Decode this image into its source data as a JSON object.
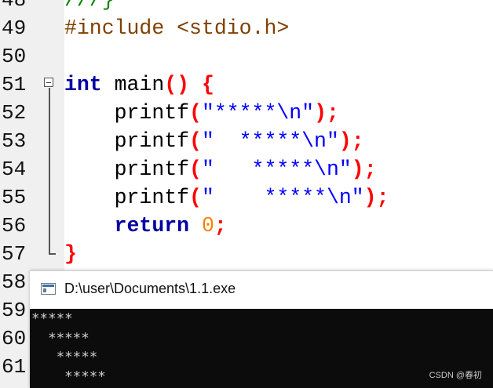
{
  "editor": {
    "partial_top_line": {
      "number": "48",
      "code": "///}"
    },
    "lines": [
      {
        "number": "49",
        "tokens": [
          {
            "t": "#include <stdio.h>",
            "k": "preproc"
          }
        ]
      },
      {
        "number": "50",
        "tokens": []
      },
      {
        "number": "51",
        "tokens": [
          {
            "t": "int",
            "k": "keyword"
          },
          {
            "t": " main",
            "k": "default"
          },
          {
            "t": "()",
            "k": "brace"
          },
          {
            "t": " ",
            "k": "default"
          },
          {
            "t": "{",
            "k": "brace"
          }
        ]
      },
      {
        "number": "52",
        "tokens": [
          {
            "t": "    printf",
            "k": "default"
          },
          {
            "t": "(",
            "k": "brace"
          },
          {
            "t": "\"*****\\n\"",
            "k": "string"
          },
          {
            "t": ")",
            "k": "brace"
          },
          {
            "t": ";",
            "k": "operator"
          }
        ]
      },
      {
        "number": "53",
        "tokens": [
          {
            "t": "    printf",
            "k": "default"
          },
          {
            "t": "(",
            "k": "brace"
          },
          {
            "t": "\"  *****\\n\"",
            "k": "string"
          },
          {
            "t": ")",
            "k": "brace"
          },
          {
            "t": ";",
            "k": "operator"
          }
        ]
      },
      {
        "number": "54",
        "tokens": [
          {
            "t": "    printf",
            "k": "default"
          },
          {
            "t": "(",
            "k": "brace"
          },
          {
            "t": "\"   *****\\n\"",
            "k": "string"
          },
          {
            "t": ")",
            "k": "brace"
          },
          {
            "t": ";",
            "k": "operator"
          }
        ]
      },
      {
        "number": "55",
        "tokens": [
          {
            "t": "    printf",
            "k": "default"
          },
          {
            "t": "(",
            "k": "brace"
          },
          {
            "t": "\"    *****\\n\"",
            "k": "string"
          },
          {
            "t": ")",
            "k": "brace"
          },
          {
            "t": ";",
            "k": "operator"
          }
        ]
      },
      {
        "number": "56",
        "tokens": [
          {
            "t": "    ",
            "k": "default"
          },
          {
            "t": "return",
            "k": "keyword"
          },
          {
            "t": " ",
            "k": "default"
          },
          {
            "t": "0",
            "k": "number"
          },
          {
            "t": ";",
            "k": "operator"
          }
        ]
      },
      {
        "number": "57",
        "tokens": [
          {
            "t": "}",
            "k": "brace"
          }
        ]
      },
      {
        "number": "58",
        "tokens": []
      },
      {
        "number": "59",
        "tokens": []
      },
      {
        "number": "60",
        "tokens": []
      },
      {
        "number": "61",
        "tokens": []
      }
    ],
    "colors": {
      "preproc": "#804000",
      "keyword": "#0000a0",
      "brace": "#ff0000",
      "string": "#0000ff",
      "number": "#ff8000",
      "gutter_bg": "#f0f0f0"
    }
  },
  "console_window": {
    "title": "D:\\user\\Documents\\1.1.exe",
    "icon": "console-app-icon",
    "output_lines": [
      "*****",
      "  *****",
      "   *****",
      "    *****"
    ],
    "colors": {
      "background": "#0c0c0c",
      "text": "#cccccc"
    }
  },
  "watermark": "CSDN @春初"
}
